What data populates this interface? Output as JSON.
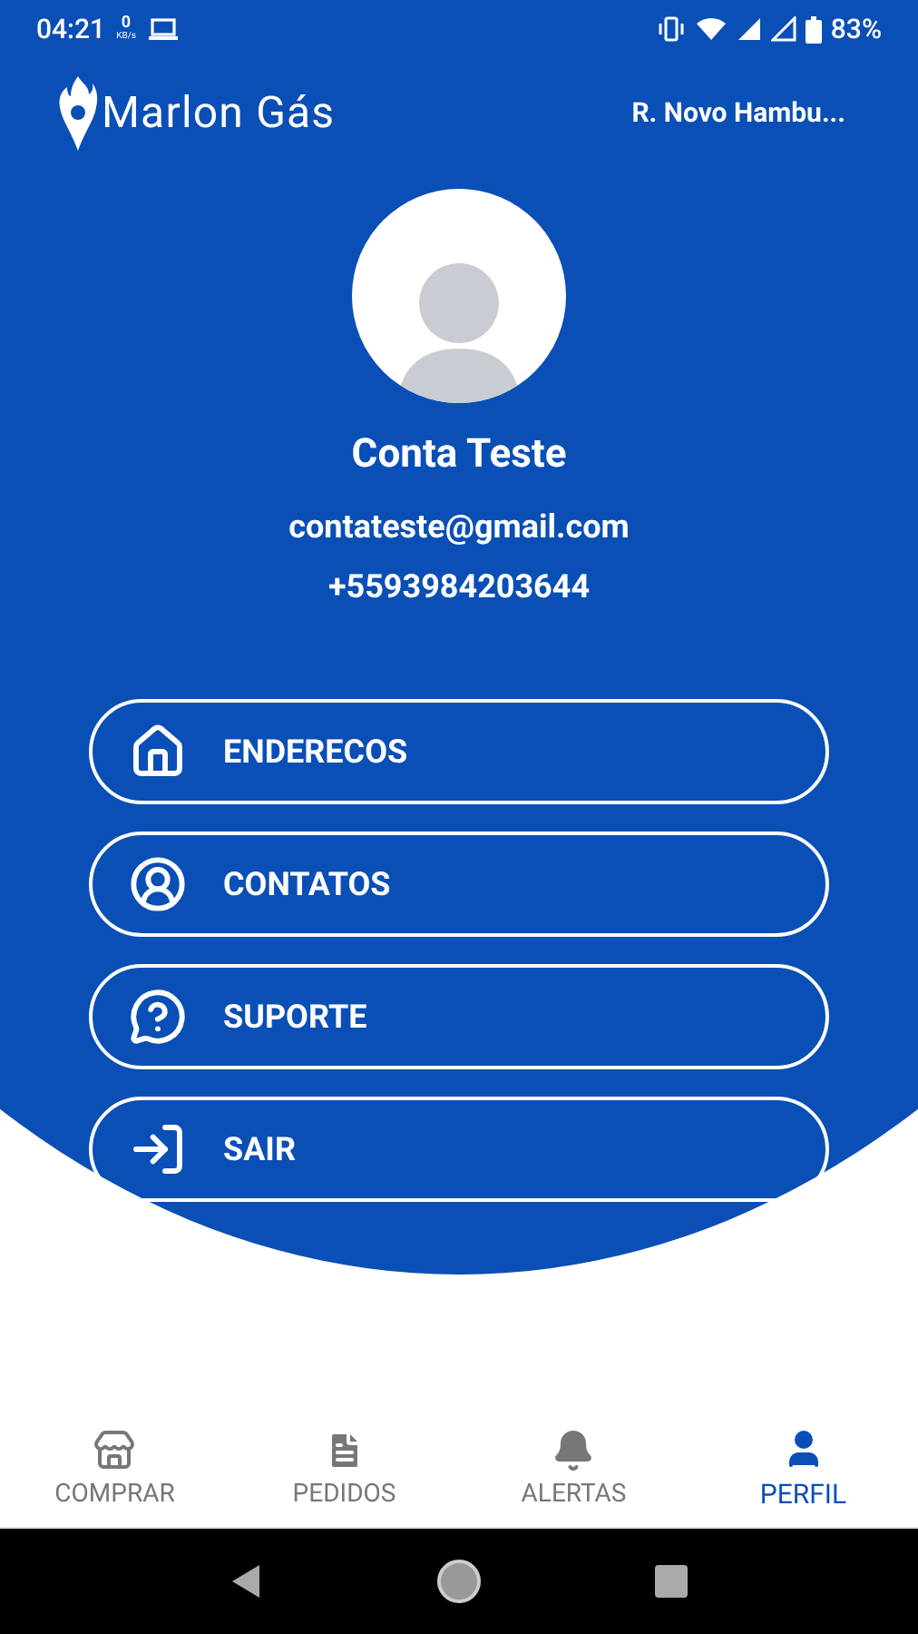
{
  "status_bar": {
    "time": "04:21",
    "net_speed": "0",
    "net_unit": "KB/s",
    "battery": "83%"
  },
  "header": {
    "brand": "Marlon Gás",
    "address": "R. Novo Hambu..."
  },
  "profile": {
    "name": "Conta Teste",
    "email": "contateste@gmail.com",
    "phone": "+5593984203644"
  },
  "menu": [
    {
      "kind": "home",
      "label": "ENDERECOS"
    },
    {
      "kind": "contact",
      "label": "CONTATOS"
    },
    {
      "kind": "help",
      "label": "SUPORTE"
    },
    {
      "kind": "exit",
      "label": "SAIR"
    }
  ],
  "bottom_nav": [
    {
      "kind": "store",
      "label": "COMPRAR",
      "selected": false
    },
    {
      "kind": "orders",
      "label": "PEDIDOS",
      "selected": false
    },
    {
      "kind": "alerts",
      "label": "ALERTAS",
      "selected": false
    },
    {
      "kind": "profile",
      "label": "PERFIL",
      "selected": true
    }
  ]
}
